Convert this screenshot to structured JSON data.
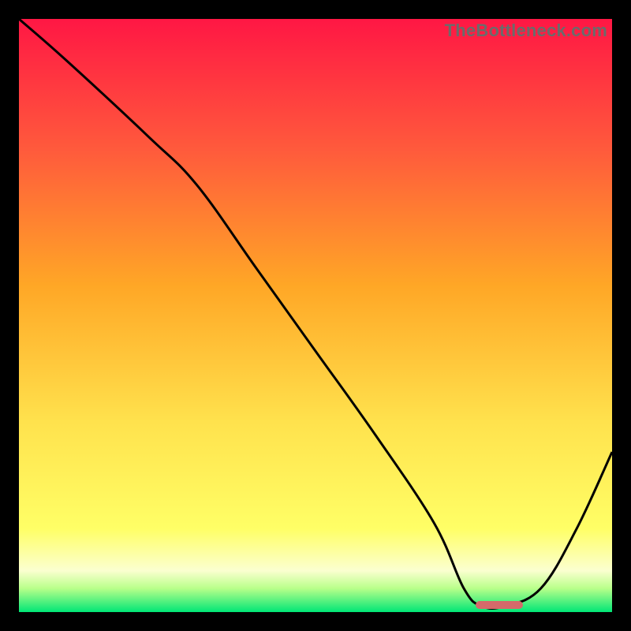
{
  "watermark": "TheBottleneck.com",
  "colors": {
    "gradient_stops": [
      {
        "pct": 0,
        "color": "#ff1744"
      },
      {
        "pct": 22,
        "color": "#ff5a3c"
      },
      {
        "pct": 45,
        "color": "#ffa726"
      },
      {
        "pct": 68,
        "color": "#ffe24d"
      },
      {
        "pct": 86,
        "color": "#ffff66"
      },
      {
        "pct": 93,
        "color": "#fbffd0"
      },
      {
        "pct": 96,
        "color": "#b9ff8a"
      },
      {
        "pct": 100,
        "color": "#00e676"
      }
    ],
    "curve": "#000000",
    "marker": "#d46a6a",
    "frame": "#000000"
  },
  "chart_data": {
    "type": "line",
    "title": "",
    "xlabel": "",
    "ylabel": "",
    "xlim": [
      0,
      100
    ],
    "ylim": [
      0,
      100
    ],
    "series": [
      {
        "name": "bottleneck-curve",
        "x": [
          0,
          8,
          22,
          30,
          40,
          50,
          60,
          70,
          75,
          78,
          82,
          88,
          94,
          100
        ],
        "y": [
          100,
          93,
          80,
          72,
          58,
          44,
          30,
          15,
          4,
          1,
          1,
          4,
          14,
          27
        ]
      }
    ],
    "marker": {
      "x_start": 77,
      "x_end": 85,
      "y": 1.2
    }
  }
}
